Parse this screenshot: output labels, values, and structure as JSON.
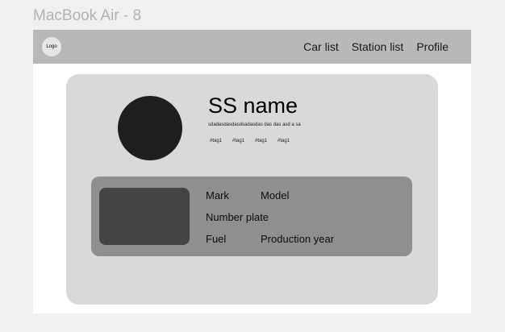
{
  "frame": {
    "title": "MacBook Air - 8"
  },
  "navbar": {
    "logo": "Logo",
    "links": [
      "Car list",
      "Station list",
      "Profile"
    ]
  },
  "station": {
    "name": "SS name",
    "description": "sdadasdasdasdsadasdas das das asd a sa",
    "tags": [
      "#tag1",
      "#tag1",
      "#tag1",
      "#tag1"
    ]
  },
  "car": {
    "mark": "Mark",
    "model": "Model",
    "number_plate": "Number plate",
    "fuel": "Fuel",
    "production_year": "Production year"
  },
  "colors": {
    "navbar": "#b8b8b8",
    "card": "#d9d9d9",
    "car_panel": "#8f8f8f",
    "car_image": "#444444",
    "avatar": "#1e1e1e"
  }
}
